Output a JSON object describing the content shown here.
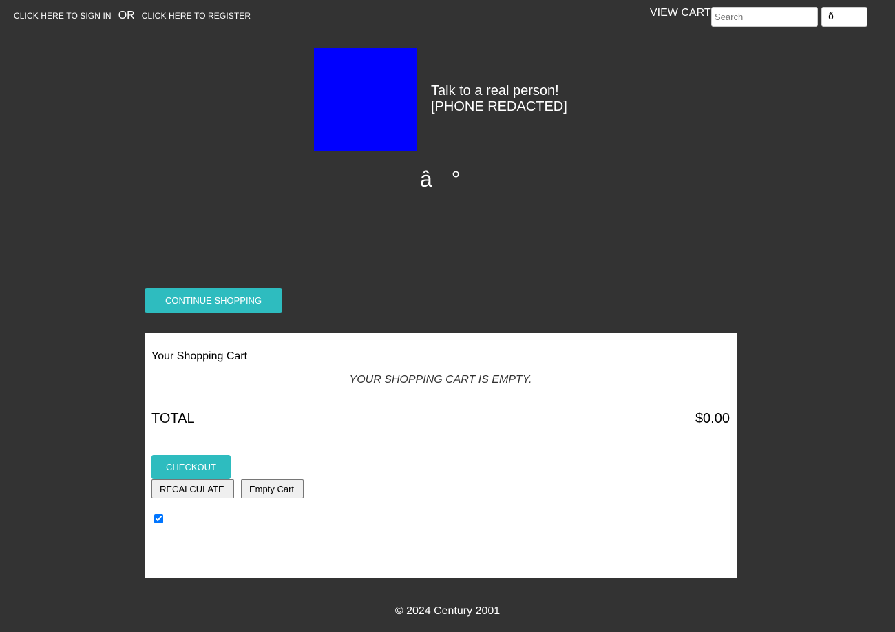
{
  "top_bar": {
    "sign_in_label": "CLICK HERE TO SIGN IN",
    "or_label": "OR",
    "register_label": "CLICK HERE TO REGISTER",
    "view_cart_label": "VIEW CART",
    "search": {
      "placeholder": "Search",
      "value": "",
      "button_label": "ð"
    }
  },
  "header": {
    "logo_color": "#0000ff",
    "contact_line1": "Talk to a real person!",
    "contact_line2": "[PHONE REDACTED]",
    "glyphs": [
      "â",
      "°"
    ]
  },
  "continue_shopping_label": "CONTINUE SHOPPING",
  "cart": {
    "title": "Your Shopping Cart",
    "empty_message": "YOUR SHOPPING CART IS EMPTY.",
    "total_label": "TOTAL",
    "total_value": "$0.00",
    "checkout_label": "CHECKOUT",
    "recalculate_label": "RECALCULATE",
    "empty_cart_label": "Empty Cart",
    "checkbox_checked": true
  },
  "footer": {
    "copyright": "© 2024 Century 2001"
  },
  "colors": {
    "background": "#333333",
    "accent": "#2ebcbf",
    "panel": "#ffffff"
  }
}
